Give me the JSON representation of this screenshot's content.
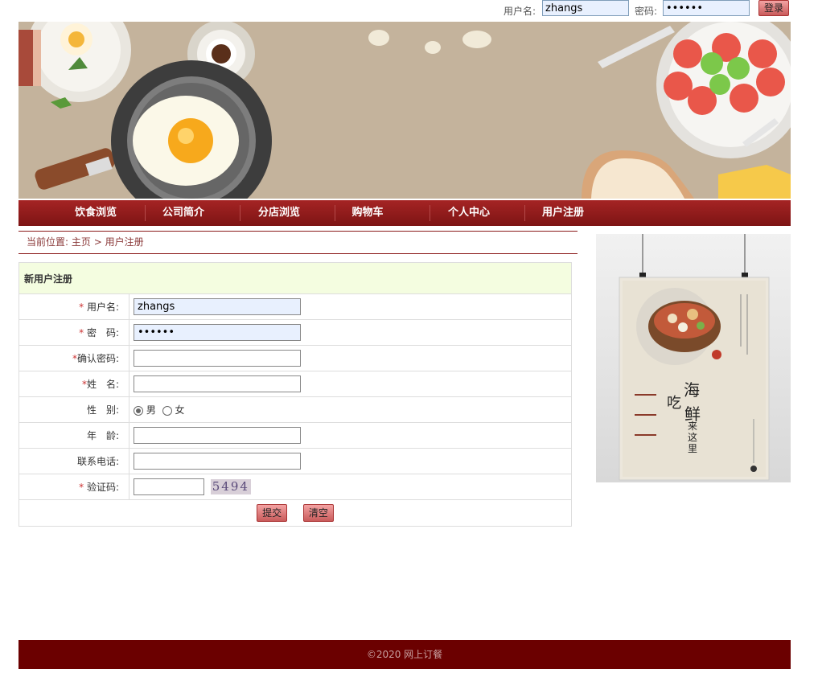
{
  "login": {
    "username_label": "用户名:",
    "username_value": "zhangs",
    "password_label": "密码:",
    "password_value": "••••••",
    "login_button": "登录"
  },
  "nav": {
    "items": [
      "饮食浏览",
      "公司简介",
      "分店浏览",
      "购物车",
      "个人中心",
      "用户注册"
    ]
  },
  "breadcrumb": {
    "prefix": "当前位置:",
    "home": "主页",
    "sep": " > ",
    "current": "用户注册"
  },
  "form": {
    "title": "新用户注册",
    "required_mark": "*",
    "username_label": "用户名:",
    "username_value": "zhangs",
    "password_label": "密　码:",
    "password_value": "••••••",
    "confirm_label": "确认密码:",
    "name_label": "姓　名:",
    "gender_label": "性　别:",
    "gender_male": "男",
    "gender_female": "女",
    "age_label": "年　龄:",
    "phone_label": "联系电话:",
    "captcha_label": "验证码:",
    "captcha_text": "5494",
    "submit_button": "提交",
    "reset_button": "清空"
  },
  "poster": {
    "text1": "海",
    "text2": "吃",
    "text3": "鲜",
    "text4": "来这里"
  },
  "footer": {
    "text": "©2020 网上订餐"
  }
}
